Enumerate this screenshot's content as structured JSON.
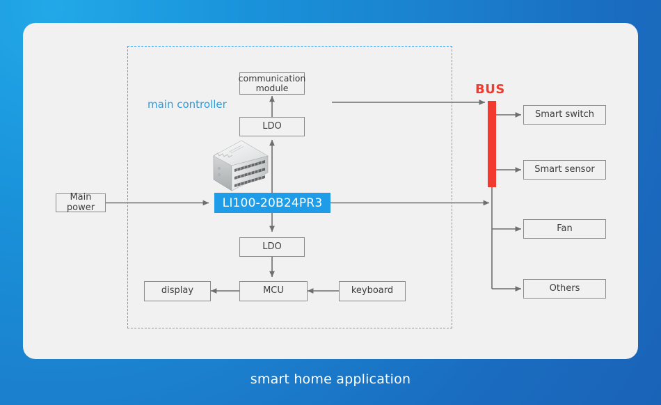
{
  "caption": "smart home application",
  "region": {
    "label": "main controller",
    "border_color": "#3fa9f5"
  },
  "bus": {
    "label": "BUS",
    "color": "#f23a2e"
  },
  "product": {
    "label": "LI100-20B24PR3",
    "highlight_color": "#1e9ce8",
    "image_name": "din-rail-power-supply"
  },
  "blocks": {
    "main_power": "Main power",
    "communication_module": "communication module",
    "ldo_top": "LDO",
    "ldo_bottom": "LDO",
    "mcu": "MCU",
    "display": "display",
    "keyboard": "keyboard"
  },
  "loads": [
    {
      "label": "Smart switch"
    },
    {
      "label": "Smart sensor"
    },
    {
      "label": "Fan"
    },
    {
      "label": "Others"
    }
  ],
  "colors": {
    "background_top_left": "#22a8e8",
    "background_bottom_right": "#1a63b8",
    "card": "#f1f1f1",
    "line": "#6e6e6e",
    "box_border": "#8a8a8a",
    "text": "#3c3c3c"
  }
}
